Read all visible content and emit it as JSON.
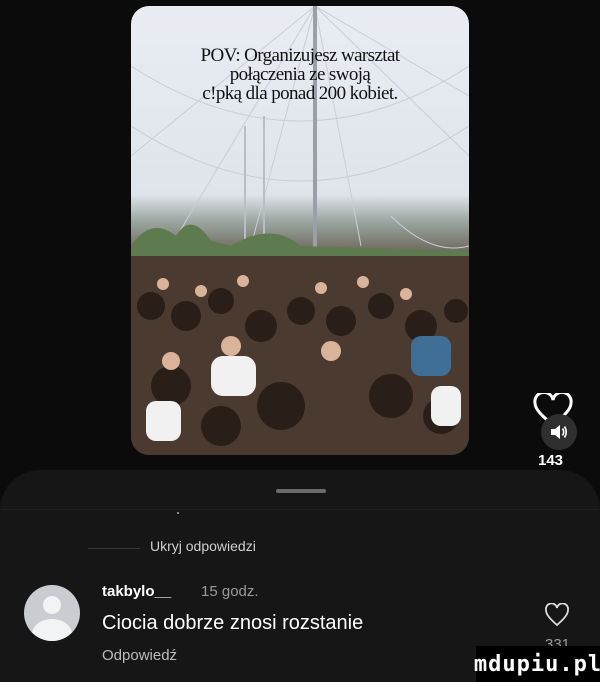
{
  "video": {
    "caption_lines": [
      "POV: Organizujesz warsztat",
      "połączenia ze swoją",
      "c!pką dla ponad 200 kobiet."
    ]
  },
  "actions": {
    "like_icon": "heart-outline-icon",
    "sound_icon": "speaker-icon",
    "like_count": "143"
  },
  "comments": {
    "replies_toggle": "Ukryj odpowiedzi",
    "items": [
      {
        "username": "takbylo__",
        "timestamp": "15 godz.",
        "text": "Ciocia dobrze znosi rozstanie",
        "reply_label": "Odpowiedź",
        "like_count": "331"
      }
    ]
  },
  "watermark": "mdupiu.pl",
  "colors": {
    "background": "#0b0b0b",
    "sheet": "#161616",
    "muted_text": "#9a9a9a"
  }
}
